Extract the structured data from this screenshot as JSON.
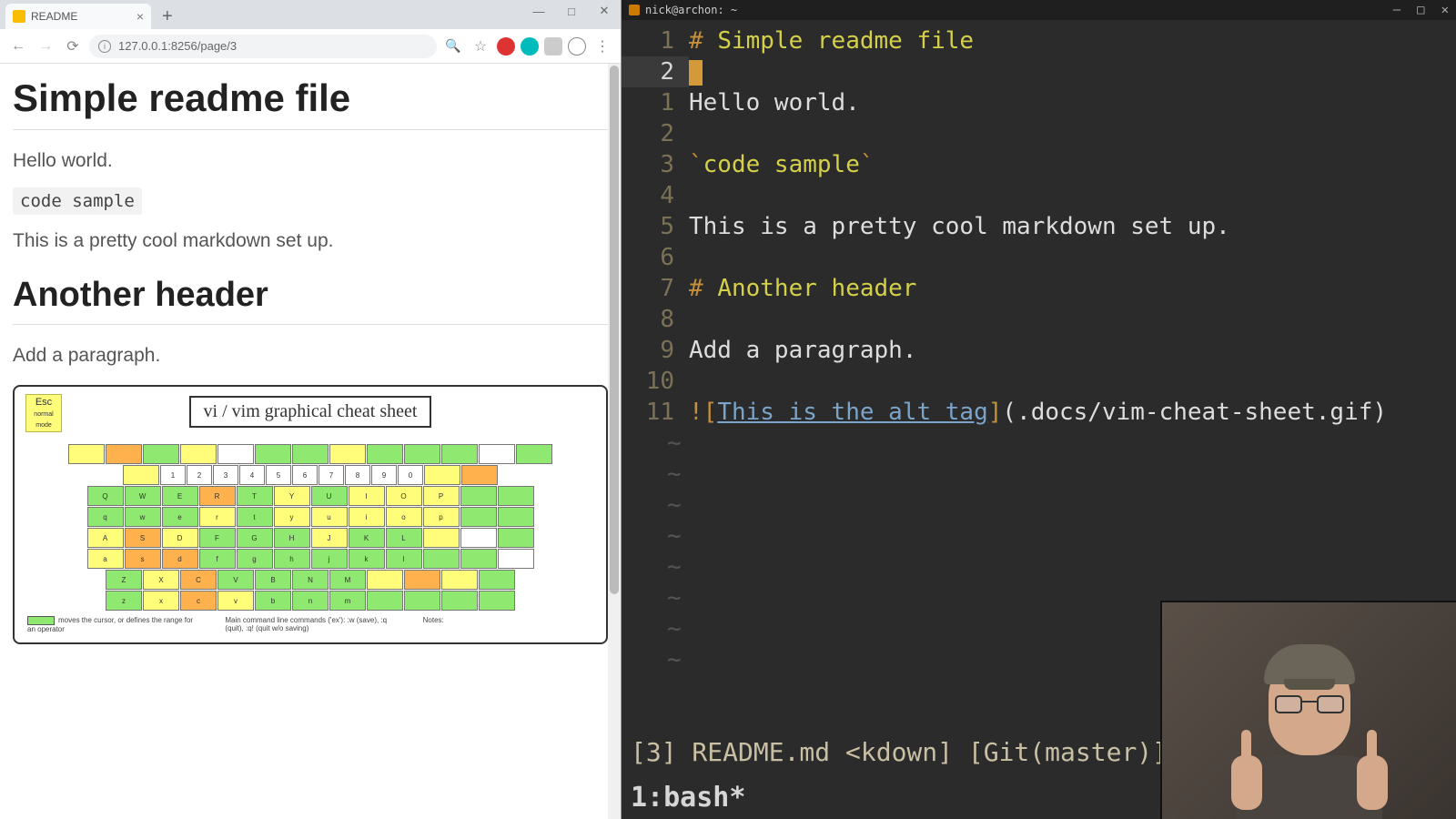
{
  "browser": {
    "tab_title": "README",
    "url": "127.0.0.1:8256/page/3",
    "window_controls": {
      "min": "—",
      "max": "□",
      "close": "✕"
    }
  },
  "page": {
    "h1": "Simple readme file",
    "p1": "Hello world.",
    "code": "code sample",
    "p2": "This is a pretty cool markdown set up.",
    "h2": "Another header",
    "p3": "Add a paragraph.",
    "img_alt": "This is the alt tag",
    "cheat_title": "vi / vim graphical cheat sheet",
    "esc": "Esc",
    "notes_a": "moves the cursor, or defines the range for an operator",
    "notes_b": "Main command line commands ('ex'): :w (save), :q (quit), :q! (quit w/o saving)",
    "notes_c": "Notes:"
  },
  "terminal": {
    "title": "nick@archon: ~",
    "lines": [
      {
        "n": "1",
        "type": "h",
        "hash": "# ",
        "text": "Simple readme file"
      },
      {
        "n": "2",
        "type": "cursor"
      },
      {
        "n": "1",
        "type": "p",
        "text": "Hello world."
      },
      {
        "n": "2",
        "type": "blank"
      },
      {
        "n": "3",
        "type": "code",
        "tick": "`",
        "text": "code sample",
        "tick2": "`"
      },
      {
        "n": "4",
        "type": "blank"
      },
      {
        "n": "5",
        "type": "p",
        "text": "This is a pretty cool markdown set up."
      },
      {
        "n": "6",
        "type": "blank"
      },
      {
        "n": "7",
        "type": "h",
        "hash": "# ",
        "text": "Another header"
      },
      {
        "n": "8",
        "type": "blank"
      },
      {
        "n": "9",
        "type": "p",
        "text": "Add a paragraph."
      },
      {
        "n": "10",
        "type": "blank"
      },
      {
        "n": "11",
        "type": "img",
        "bang": "!",
        "lb": "[",
        "alt": "This is the alt tag",
        "rb": "]",
        "lp": "(",
        "path": ".docs/vim-cheat-sheet.gif",
        "rp": ")"
      }
    ],
    "statusline": "[3]  README.md <kdown]  [Git(master)]",
    "tmux": "1:bash*"
  }
}
